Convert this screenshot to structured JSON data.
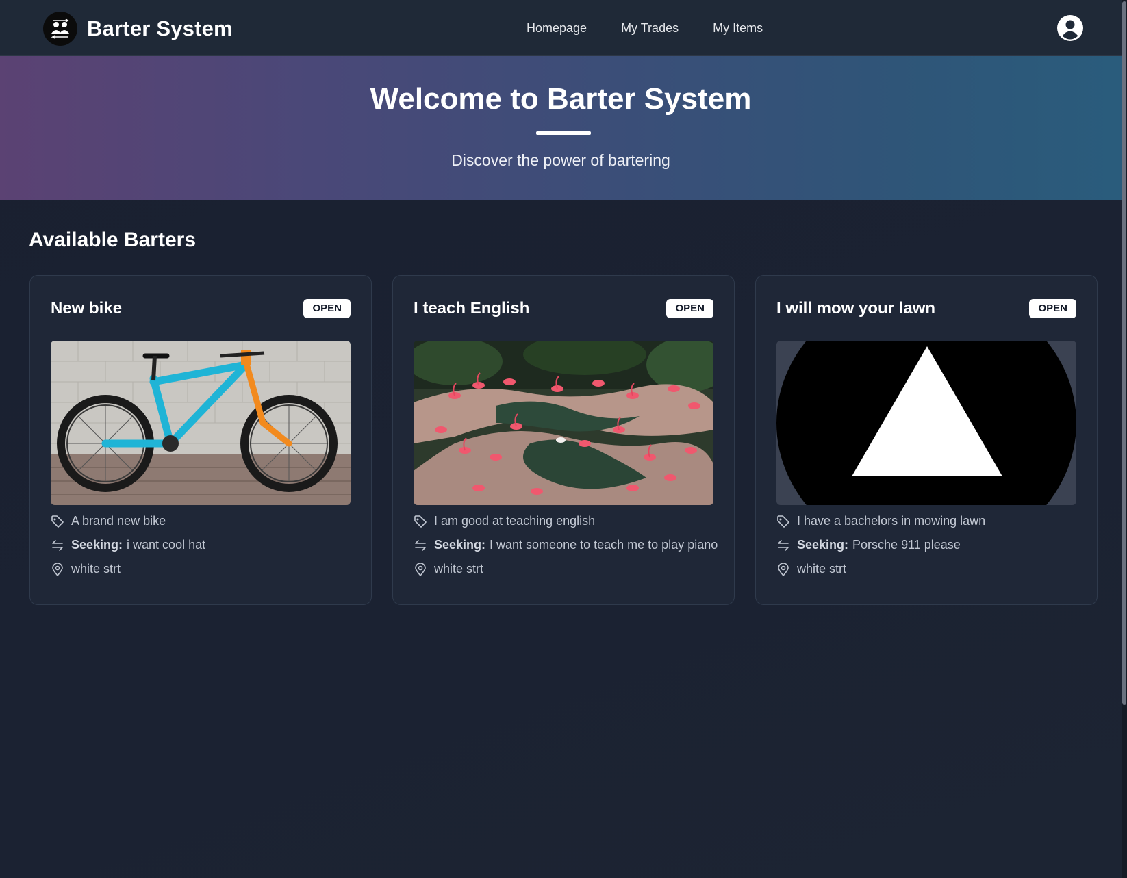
{
  "app": {
    "name": "Barter System"
  },
  "nav": {
    "links": [
      "Homepage",
      "My Trades",
      "My Items"
    ]
  },
  "hero": {
    "title": "Welcome to Barter System",
    "subtitle": "Discover the power of bartering"
  },
  "section": {
    "title": "Available Barters"
  },
  "seeking_label": "Seeking:",
  "cards": [
    {
      "title": "New bike",
      "status": "OPEN",
      "description": "A brand new bike",
      "seeking": "i want cool hat",
      "location": "white strt",
      "image": "mountain-bike-photo"
    },
    {
      "title": "I teach English",
      "status": "OPEN",
      "description": "I am good at teaching english",
      "seeking": "I want someone to teach me to play piano",
      "location": "white strt",
      "image": "flamingos-photo"
    },
    {
      "title": "I will mow your lawn",
      "status": "OPEN",
      "description": "I have a bachelors in mowing lawn",
      "seeking": "Porsche 911 please",
      "location": "white strt",
      "image": "triangle-logo"
    }
  ],
  "colors": {
    "navbar": "#1f2937",
    "page": "#1b2230",
    "card": "#1f2737",
    "hero_start": "#5b4273",
    "hero_end": "#2a5c7c",
    "bike_frame": "#1fb4d6",
    "bike_fork": "#f28a1e",
    "flamingo": "#f0586e"
  },
  "icons": {
    "logo": "people-exchange-icon",
    "profile": "user-circle-icon",
    "description": "tag-icon",
    "seeking": "swap-arrows-icon",
    "location": "map-pin-icon"
  }
}
